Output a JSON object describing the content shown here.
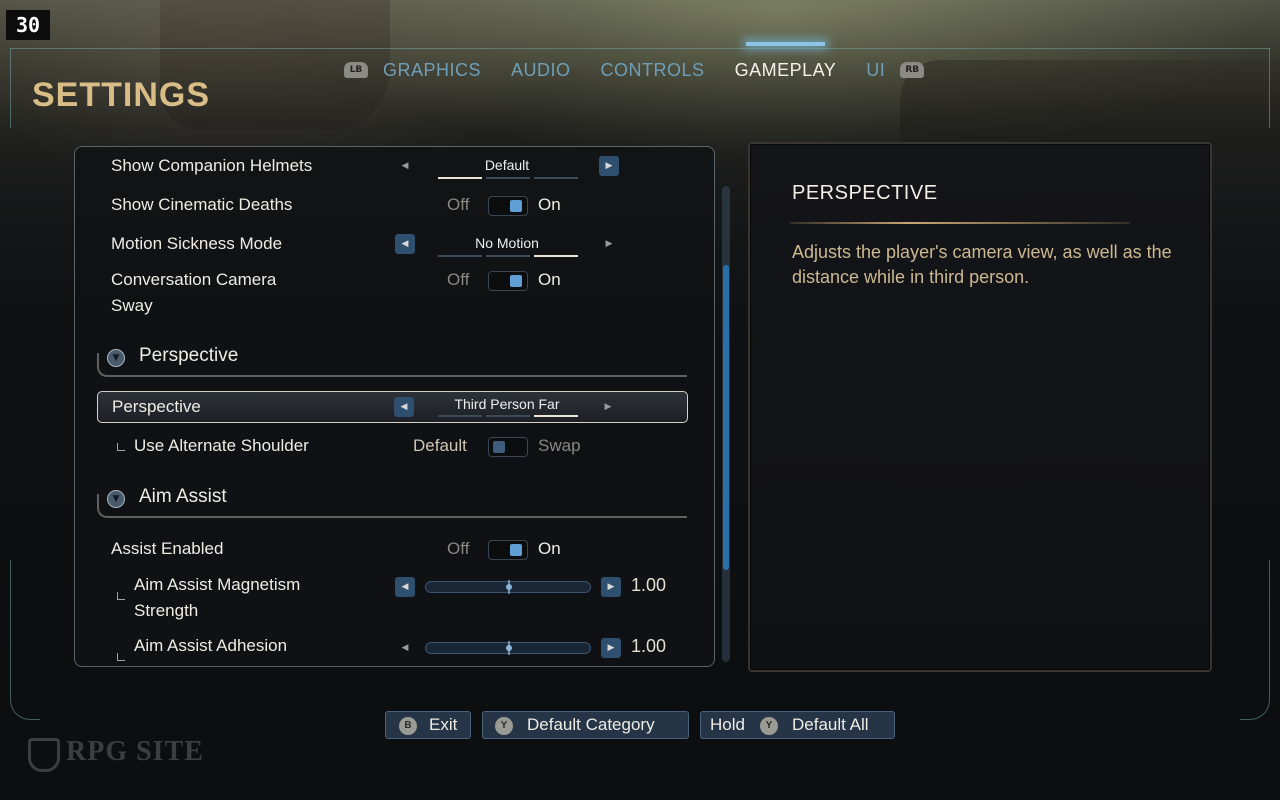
{
  "fps_counter": "30",
  "title": "SETTINGS",
  "tabs": {
    "left_bumper": "LB",
    "right_bumper": "RB",
    "items": [
      {
        "label": "GRAPHICS"
      },
      {
        "label": "AUDIO"
      },
      {
        "label": "CONTROLS"
      },
      {
        "label": "GAMEPLAY"
      },
      {
        "label": "UI"
      }
    ],
    "active": "GAMEPLAY"
  },
  "settings": {
    "show_companion_helmets": {
      "label": "Show Companion Helmets",
      "value": "Default"
    },
    "show_cinematic_deaths": {
      "label": "Show Cinematic Deaths",
      "off": "Off",
      "on": "On",
      "state": "On"
    },
    "motion_sickness_mode": {
      "label": "Motion Sickness Mode",
      "value": "No Motion"
    },
    "conversation_camera_sway": {
      "label_line1": "Conversation Camera",
      "label_line2": "Sway",
      "off": "Off",
      "on": "On",
      "state": "On"
    },
    "section_perspective": {
      "title": "Perspective"
    },
    "perspective": {
      "label": "Perspective",
      "value": "Third Person Far"
    },
    "use_alternate_shoulder": {
      "label": "Use Alternate Shoulder",
      "off": "Default",
      "on": "Swap",
      "state": "Default"
    },
    "section_aim_assist": {
      "title": "Aim Assist"
    },
    "assist_enabled": {
      "label": "Assist Enabled",
      "off": "Off",
      "on": "On",
      "state": "On"
    },
    "aim_assist_magnetism": {
      "label_line1": "Aim Assist Magnetism",
      "label_line2": "Strength",
      "value": "1.00",
      "fraction": 0.5
    },
    "aim_assist_adhesion": {
      "label": "Aim Assist Adhesion",
      "value": "1.00",
      "fraction": 0.5
    }
  },
  "info": {
    "title": "PERSPECTIVE",
    "description": "Adjusts the player's camera view, as well as the distance while in third person."
  },
  "hints": {
    "exit": {
      "button": "B",
      "label": "Exit"
    },
    "default_category": {
      "button": "Y",
      "label": "Default Category"
    },
    "default_all": {
      "prefix": "Hold",
      "button": "Y",
      "label": "Default All"
    }
  },
  "watermark": "RPG SITE",
  "colors": {
    "accent_gold": "#d9bd86",
    "tab_inactive": "#6f9fb8",
    "toggle_blue": "#5f9fd6",
    "description_text": "#cdb892"
  }
}
